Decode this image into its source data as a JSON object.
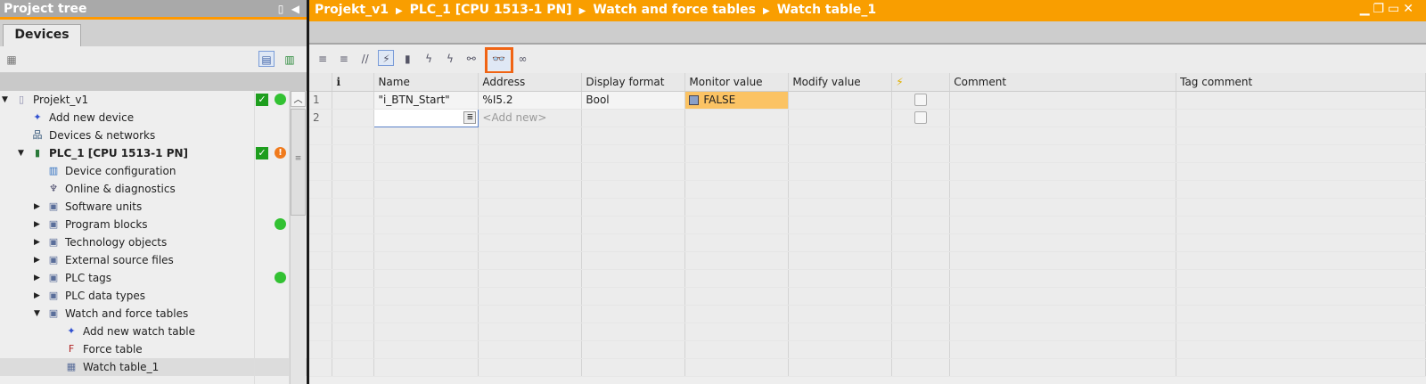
{
  "project_tree": {
    "title": "Project tree",
    "tab": "Devices",
    "items": [
      {
        "label": "Projekt_v1",
        "level": 0,
        "arrow": "down",
        "icon": "project-icon",
        "status": [
          "ok",
          "online"
        ]
      },
      {
        "label": "Add new device",
        "level": 1,
        "icon": "add-device-icon"
      },
      {
        "label": "Devices & networks",
        "level": 1,
        "icon": "network-icon"
      },
      {
        "label": "PLC_1 [CPU 1513-1 PN]",
        "level": 1,
        "arrow": "down",
        "icon": "plc-icon",
        "bold": true,
        "status": [
          "ok",
          "warning"
        ]
      },
      {
        "label": "Device configuration",
        "level": 2,
        "icon": "device-config-icon"
      },
      {
        "label": "Online & diagnostics",
        "level": 2,
        "icon": "diagnostics-icon"
      },
      {
        "label": "Software units",
        "level": 2,
        "arrow": "right",
        "icon": "folder-icon"
      },
      {
        "label": "Program blocks",
        "level": 2,
        "arrow": "right",
        "icon": "folder-icon",
        "status": [
          "",
          "online"
        ]
      },
      {
        "label": "Technology objects",
        "level": 2,
        "arrow": "right",
        "icon": "folder-icon"
      },
      {
        "label": "External source files",
        "level": 2,
        "arrow": "right",
        "icon": "folder-icon"
      },
      {
        "label": "PLC tags",
        "level": 2,
        "arrow": "right",
        "icon": "folder-icon",
        "status": [
          "",
          "online"
        ]
      },
      {
        "label": "PLC data types",
        "level": 2,
        "arrow": "right",
        "icon": "folder-icon"
      },
      {
        "label": "Watch and force tables",
        "level": 2,
        "arrow": "down",
        "icon": "folder-icon"
      },
      {
        "label": "Add new watch table",
        "level": 3,
        "icon": "add-table-icon"
      },
      {
        "label": "Force table",
        "level": 3,
        "icon": "force-table-icon"
      },
      {
        "label": "Watch table_1",
        "level": 3,
        "icon": "watch-table-icon",
        "selected": true
      }
    ]
  },
  "breadcrumb": [
    "Projekt_v1",
    "PLC_1 [CPU 1513-1 PN]",
    "Watch and force tables",
    "Watch table_1"
  ],
  "table": {
    "columns": [
      "",
      "i",
      "Name",
      "Address",
      "Display format",
      "Monitor value",
      "Modify value",
      "⚡",
      "Comment",
      "Tag comment"
    ],
    "rows": [
      {
        "num": "1",
        "name": "\"i_BTN_Start\"",
        "address": "%I5.2",
        "format": "Bool",
        "monitor": "FALSE",
        "modify": "",
        "comment": "",
        "tag_comment": ""
      },
      {
        "num": "2",
        "name": "",
        "address": "<Add new>",
        "format": "",
        "monitor": "",
        "modify": "",
        "comment": "",
        "tag_comment": ""
      }
    ]
  },
  "colors": {
    "accent": "#f99e00",
    "monitor_bg": "#fbc364",
    "highlight": "#f06414"
  }
}
